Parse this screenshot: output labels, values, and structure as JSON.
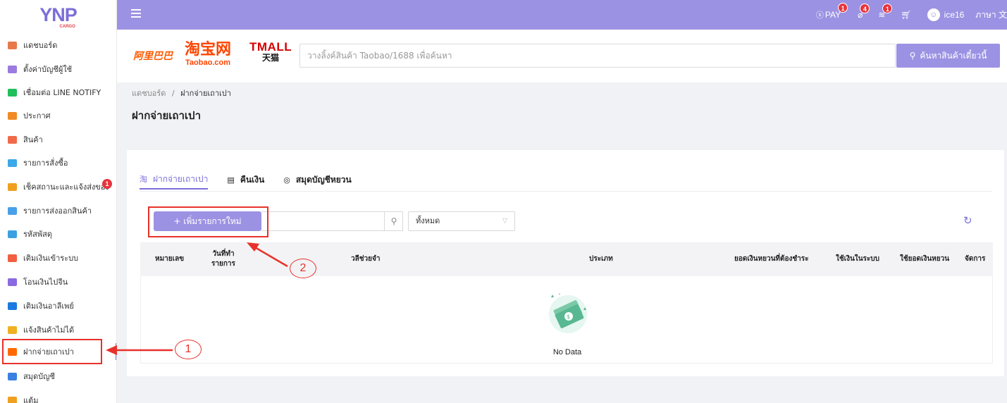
{
  "app": {
    "logo": "YNP",
    "logo_sub": "CARGO"
  },
  "sidebar": {
    "items": [
      {
        "label": "แดชบอร์ด",
        "icon": "chart-icon",
        "color": "#e8794a"
      },
      {
        "label": "ตั้งค่าบัญชีผู้ใช้",
        "icon": "user-settings-icon",
        "color": "#9c7bdf"
      },
      {
        "label": "เชื่อมต่อ LINE NOTIFY",
        "icon": "line-icon",
        "color": "#1fbf5a"
      },
      {
        "label": "ประกาศ",
        "icon": "megaphone-icon",
        "color": "#f08a24"
      },
      {
        "label": "สินค้า",
        "icon": "product-icon",
        "color": "#f06a4a"
      },
      {
        "label": "รายการสั่งซื้อ",
        "icon": "order-icon",
        "color": "#3ba8e8"
      },
      {
        "label": "เช็คสถานะและแจ้งส่งของ",
        "icon": "truck-icon",
        "color": "#f0a020",
        "badge": "1"
      },
      {
        "label": "รายการส่งออกสินค้า",
        "icon": "export-icon",
        "color": "#4aa0e8"
      },
      {
        "label": "รหัสพัสดุ",
        "icon": "box-icon",
        "color": "#3aa0e0"
      },
      {
        "label": "เติมเงินเข้าระบบ",
        "icon": "topup-icon",
        "color": "#f06040"
      },
      {
        "label": "โอนเงินไปจีน",
        "icon": "yuan-icon",
        "color": "#8a6ae0"
      },
      {
        "label": "เติมเงินอาลีเพย์",
        "icon": "alipay-icon",
        "color": "#1a7ae0"
      },
      {
        "label": "แจ้งสินค้าไม่ได้",
        "icon": "report-icon",
        "color": "#f0b020"
      },
      {
        "label": "ฝากจ่ายเถาเปา",
        "icon": "taobao-icon",
        "color": "#ff6a00"
      },
      {
        "label": "สมุดบัญชี",
        "icon": "wallet-icon",
        "color": "#3a80e0"
      },
      {
        "label": "แต้ม",
        "icon": "points-icon",
        "color": "#f0a020"
      }
    ]
  },
  "topbar": {
    "pay_label": "PAY",
    "pay_badge": "1",
    "coupon_badge": "4",
    "layers_badge": "1",
    "username": "ice16",
    "lang_label": "ภาษา 文"
  },
  "search": {
    "brand_1688": "阿里巴巴",
    "brand_taobao_cn": "淘宝网",
    "brand_taobao_com": "Taobao.com",
    "brand_tmall": "TMALL",
    "brand_tmall_sub": "天猫",
    "placeholder": "วางลิ้งค์สินค้า Taobao/1688 เพื่อค้นหา",
    "button_label": "ค้นหาสินค้าเดี๋ยวนี้"
  },
  "breadcrumb": {
    "home": "แดชบอร์ด",
    "separator": "/",
    "current": "ฝากจ่ายเถาเปา"
  },
  "page": {
    "title": "ฝากจ่ายเถาเปา"
  },
  "tabs": [
    {
      "label": "ฝากจ่ายเถาเปา",
      "icon": "淘"
    },
    {
      "label": "คืนเงิน",
      "icon": "▤"
    },
    {
      "label": "สมุดบัญชีหยวน",
      "icon": "◎"
    }
  ],
  "toolbar": {
    "add_label": "+ เพิ่มรายการใหม่",
    "filter_value": "ทั้งหมด"
  },
  "table": {
    "columns": [
      "หมายเลข",
      "วันที่ทำ\nรายการ",
      "วลีช่วยจำ",
      "ประเภท",
      "ยอดเงินหยวนที่ต้องชำระ",
      "ใช้เงินในระบบ",
      "ใช้ยอดเงินหยวน",
      "จัดการ"
    ],
    "empty_text": "No Data"
  },
  "annotations": {
    "one": "1",
    "two": "2"
  }
}
